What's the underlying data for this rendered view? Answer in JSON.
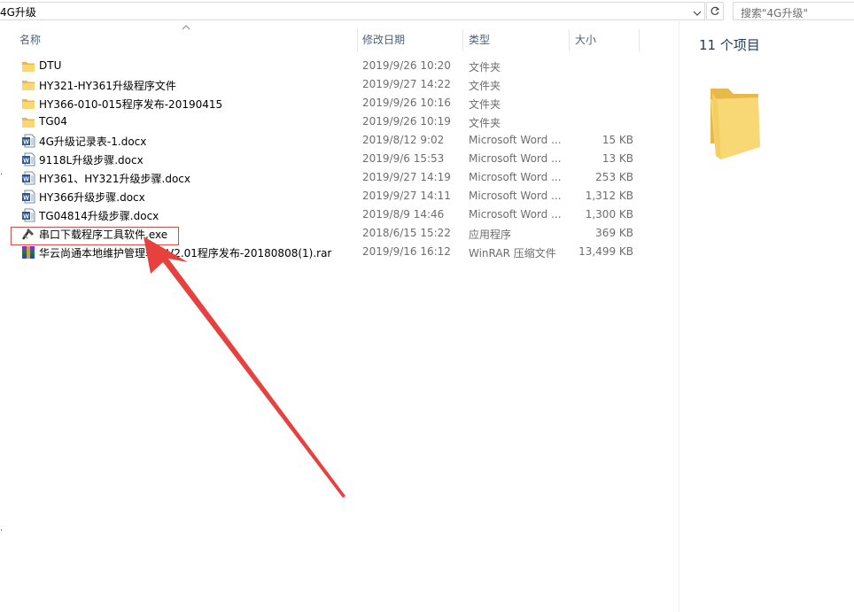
{
  "address": {
    "path": "4G升级"
  },
  "search": {
    "placeholder": "搜索\"4G升级\""
  },
  "columns": {
    "name": "名称",
    "date": "修改日期",
    "type": "类型",
    "size": "大小"
  },
  "files": [
    {
      "name": "DTU",
      "date": "2019/9/26 10:20",
      "type": "文件夹",
      "size": "",
      "icon": "folder-icon"
    },
    {
      "name": "HY321-HY361升级程序文件",
      "date": "2019/9/27 14:22",
      "type": "文件夹",
      "size": "",
      "icon": "folder-icon"
    },
    {
      "name": "HY366-010-015程序发布-20190415",
      "date": "2019/9/26 10:16",
      "type": "文件夹",
      "size": "",
      "icon": "folder-icon"
    },
    {
      "name": "TG04",
      "date": "2019/9/26 10:19",
      "type": "文件夹",
      "size": "",
      "icon": "folder-icon"
    },
    {
      "name": "4G升级记录表-1.docx",
      "date": "2019/8/12 9:02",
      "type": "Microsoft Word ...",
      "size": "15 KB",
      "icon": "word-doc-icon"
    },
    {
      "name": "9118L升级步骤.docx",
      "date": "2019/9/6 15:53",
      "type": "Microsoft Word ...",
      "size": "13 KB",
      "icon": "word-doc-icon"
    },
    {
      "name": "HY361、HY321升级步骤.docx",
      "date": "2019/9/27 14:19",
      "type": "Microsoft Word ...",
      "size": "253 KB",
      "icon": "word-doc-icon"
    },
    {
      "name": "HY366升级步骤.docx",
      "date": "2019/9/27 14:11",
      "type": "Microsoft Word ...",
      "size": "1,312 KB",
      "icon": "word-doc-icon"
    },
    {
      "name": "TG04814升级步骤.docx",
      "date": "2019/8/9 14:46",
      "type": "Microsoft Word ...",
      "size": "1,300 KB",
      "icon": "word-doc-icon"
    },
    {
      "name": "串口下载程序工具软件.exe",
      "date": "2018/6/15 15:22",
      "type": "应用程序",
      "size": "369 KB",
      "icon": "exe-tool-icon"
    },
    {
      "name": "华云尚通本地维护管理软件V2.01程序发布-20180808(1).rar",
      "date": "2019/9/16 16:12",
      "type": "WinRAR 压缩文件",
      "size": "13,499 KB",
      "icon": "rar-archive-icon"
    }
  ],
  "preview": {
    "item_count": "11 个项目"
  },
  "colors": {
    "annotation": "#e04848",
    "folder": "#f8d775",
    "word": "#2b579a",
    "header_text": "#4c607a"
  }
}
